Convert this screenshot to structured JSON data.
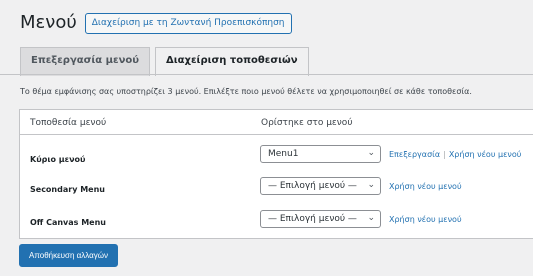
{
  "header": {
    "title": "Μενού",
    "live_preview_button": "Διαχείριση με τη Ζωντανή Προεπισκόπηση"
  },
  "tabs": [
    {
      "label": "Επεξεργασία μενού",
      "active": false
    },
    {
      "label": "Διαχείριση τοποθεσιών",
      "active": true
    }
  ],
  "description": "Το θέμα εμφάνισης σας υποστηρίζει 3 μενού. Επιλέξτε ποιο μενού θέλετε να χρησιμοποιηθεί σε κάθε τοποθεσία.",
  "table": {
    "columns": [
      "Τοποθεσία μενού",
      "Ορίστηκε στο μενού"
    ],
    "rows": [
      {
        "location": "Κύριο μενού",
        "selected": "Menu1",
        "edit_link": "Επεξεργασία",
        "new_menu_link": "Χρήση νέου μενού"
      },
      {
        "location": "Secondary Menu",
        "selected": "— Επιλογή μενού —",
        "new_menu_link": "Χρήση νέου μενού"
      },
      {
        "location": "Off Canvas Menu",
        "selected": "— Επιλογή μενού —",
        "new_menu_link": "Χρήση νέου μενού"
      }
    ]
  },
  "save_button": "Αποθήκευση αλλαγών",
  "colors": {
    "accent": "#2271b1",
    "background": "#f0f0f1"
  }
}
